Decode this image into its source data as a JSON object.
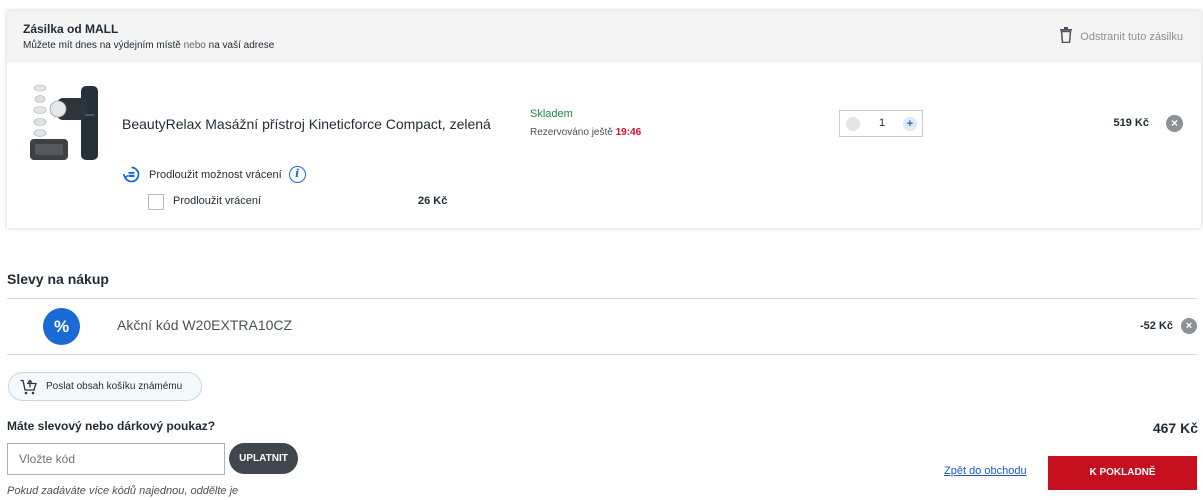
{
  "shipment": {
    "title": "Zásilka od MALL",
    "subtitle_prefix": "Můžete mít dnes na výdejním místě",
    "subtitle_or": "nebo",
    "subtitle_suffix": "na vaší adrese",
    "remove_label": "Odstranit tuto zásilku",
    "remove_icon": "trash-icon"
  },
  "item": {
    "name": "BeautyRelax Masážní přístroj Kineticforce Compact, zelená",
    "stock": "Skladem",
    "reserved_prefix": "Rezervováno ještě",
    "reserved_time": "19:46",
    "quantity": "1",
    "plus": "+",
    "price": "519 Kč",
    "remove_glyph": "×"
  },
  "extend_return": {
    "label": "Prodloužit možnost vrácení",
    "info_glyph": "i",
    "option_label": "Prodloužit vrácení",
    "option_price": "26 Kč",
    "checked": false
  },
  "discounts": {
    "title": "Slevy na nákup",
    "badge_glyph": "%",
    "code_text": "Akční kód W20EXTRA10CZ",
    "value": "-52 Kč",
    "remove_glyph": "×"
  },
  "share": {
    "label": "Poslat obsah košíku známému",
    "icon": "cart-share-icon"
  },
  "voucher": {
    "question": "Máte slevový nebo dárkový poukaz?",
    "placeholder": "Vložte kód",
    "value": "",
    "apply_label": "UPLATNIT",
    "hint": "Pokud zadáváte více kódů najednou, oddělte je"
  },
  "summary": {
    "total": "467 Kč",
    "back_label": "Zpět do obchodu",
    "checkout_label": "K POKLADNĚ"
  },
  "colors": {
    "accent_blue": "#1a6ad6",
    "checkout_red": "#c50f1f",
    "stock_green": "#1d8a3a",
    "timer_red": "#d0112b"
  }
}
